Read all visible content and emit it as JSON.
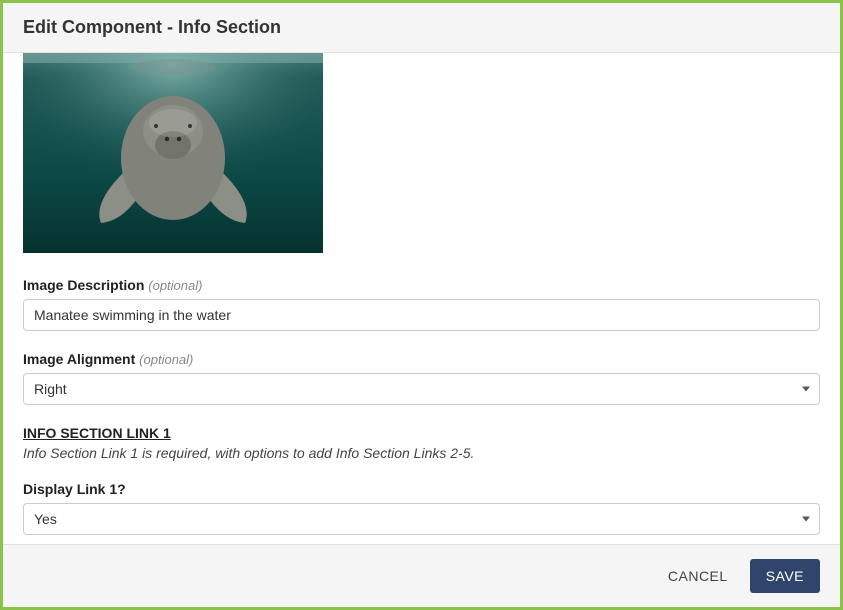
{
  "header": {
    "title": "Edit Component - Info Section"
  },
  "form": {
    "image_description": {
      "label": "Image Description",
      "optional_hint": "(optional)",
      "value": "Manatee swimming in the water"
    },
    "image_alignment": {
      "label": "Image Alignment",
      "optional_hint": "(optional)",
      "value": "Right"
    },
    "link_section": {
      "heading": "INFO SECTION LINK 1",
      "note": "Info Section Link 1 is required, with options to add Info Section Links 2-5."
    },
    "display_link_1": {
      "label": "Display Link 1?",
      "value": "Yes"
    }
  },
  "footer": {
    "cancel_label": "CANCEL",
    "save_label": "SAVE"
  }
}
